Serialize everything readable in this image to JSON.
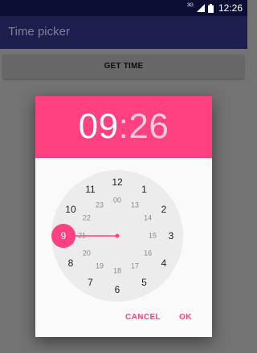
{
  "status_bar": {
    "network": "3G",
    "time": "12:26"
  },
  "app_bar": {
    "title": "Time picker"
  },
  "main": {
    "get_time_label": "GET TIME"
  },
  "dialog": {
    "hour": "09",
    "separator": ":",
    "minute": "26",
    "selected_hour": "9",
    "outer_hours": [
      "12",
      "1",
      "2",
      "3",
      "4",
      "5",
      "6",
      "7",
      "8",
      "9",
      "10",
      "11"
    ],
    "inner_hours": [
      "00",
      "13",
      "14",
      "15",
      "16",
      "17",
      "18",
      "19",
      "20",
      "21",
      "22",
      "23"
    ],
    "cancel_label": "CANCEL",
    "ok_label": "OK"
  },
  "colors": {
    "accent": "#ff4081",
    "app_bar": "#1c1f4e",
    "status_bar": "#0c0e33",
    "scrim": "#737373",
    "clock_face": "#ececec"
  }
}
